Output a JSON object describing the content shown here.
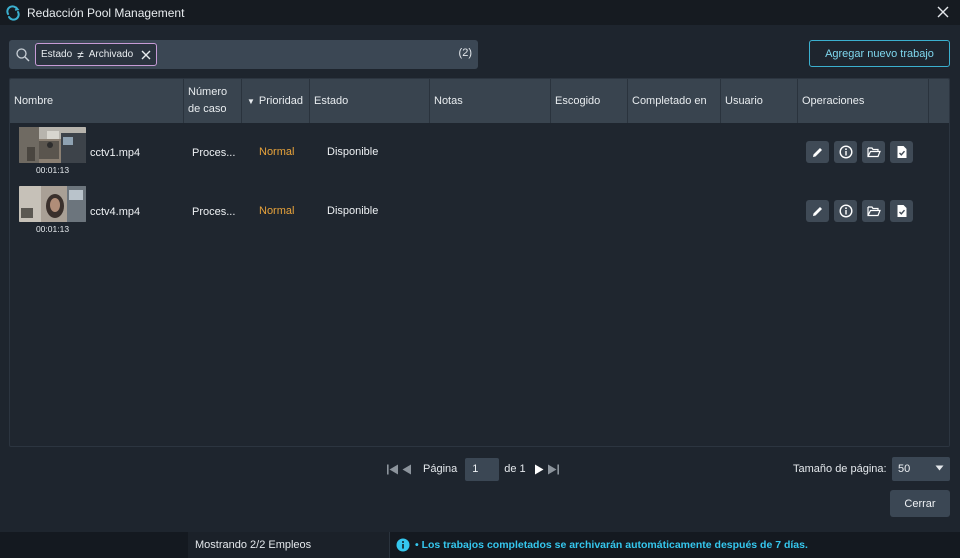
{
  "window": {
    "title": "Redacción Pool Management"
  },
  "search": {
    "filter": {
      "field": "Estado",
      "operator": "≠",
      "value": "Archivado"
    },
    "count": "(2)"
  },
  "actions": {
    "add_label": "Agregar nuevo trabajo",
    "close_label": "Cerrar"
  },
  "table": {
    "columns": {
      "nombre": "Nombre",
      "numero_line1": "Número",
      "numero_line2": "de caso",
      "prioridad": "Prioridad",
      "estado": "Estado",
      "notas": "Notas",
      "escogido": "Escogido",
      "completado": "Completado en",
      "usuario": "Usuario",
      "operaciones": "Operaciones"
    },
    "rows": [
      {
        "duration": "00:01:13",
        "name": "cctv1.mp4",
        "case": "Proces...",
        "priority": "Normal",
        "status": "Disponible",
        "ops": [
          "edit-icon",
          "info-icon",
          "folder-open-icon",
          "file-check-icon"
        ]
      },
      {
        "duration": "00:01:13",
        "name": "cctv4.mp4",
        "case": "Proces...",
        "priority": "Normal",
        "status": "Disponible",
        "ops": [
          "edit-icon",
          "info-icon",
          "folder-open-icon",
          "file-check-icon"
        ]
      }
    ]
  },
  "pagination": {
    "page_label": "Página",
    "current_page": "1",
    "of_label": "de 1",
    "page_size_label": "Tamaño de página:",
    "page_size": "50"
  },
  "status": {
    "showing": "Mostrando 2/2 Empleos",
    "message": "• Los trabajos completados se archivarán automáticamente después de 7 días."
  },
  "colors": {
    "accent": "#3bb0cf",
    "priority": "#e8a33b",
    "info": "#35c7ee"
  }
}
